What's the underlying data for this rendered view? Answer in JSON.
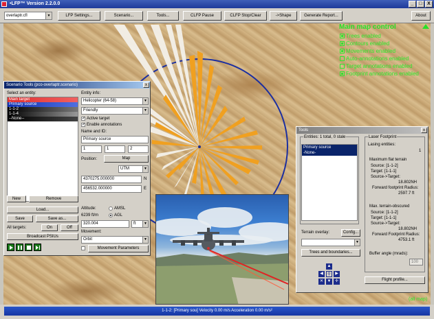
{
  "window": {
    "title": "•LFP™ Version 2.2.0.0",
    "buttons": [
      "_",
      "□",
      "X"
    ]
  },
  "toolbar": {
    "select_value": "overlaptr.cfl",
    "buttons": [
      "LFP Settings...",
      "Scenario...",
      "Tools...",
      "CLFP Pause",
      "CLFP Stop/Clear",
      "->Shape",
      "Generate Report...",
      "About"
    ]
  },
  "map_control": {
    "title": "Main map control",
    "items": [
      {
        "label": "Trees enabled",
        "checked": true
      },
      {
        "label": "Contours enabled",
        "checked": true
      },
      {
        "label": "Movements enabled",
        "checked": true
      },
      {
        "label": "Auto-annotations enabled",
        "checked": false
      },
      {
        "label": "Target annotations enabled",
        "checked": false
      },
      {
        "label": "Footprint annotations enabled",
        "checked": true
      }
    ]
  },
  "scenario_tools": {
    "title": "Scenario Tools (pco-overlaptr.scenario)",
    "select_entity_label": "Select an entity:",
    "entities": [
      {
        "label": "Main target",
        "style": "red"
      },
      {
        "label": "Primary source",
        "style": "blue"
      },
      {
        "label": "1-1-2",
        "style": "dark"
      },
      {
        "label": "1-1-4",
        "style": "dark"
      },
      {
        "label": "--None--",
        "style": "dark"
      }
    ],
    "entity_info_label": "Entity info:",
    "entity_type": "Helicopter (64-58)",
    "allegiance": "Friendly",
    "active_target_label": "Active target",
    "enable_annotations_label": "Enable annotations",
    "name_id_label": "Name and ID:",
    "name_value": "Primary source",
    "id_values": [
      "1",
      "1",
      "2"
    ],
    "position_label": "Position:",
    "map_button": "Map",
    "coord_system": "UTM",
    "northing": "4370275.000000",
    "northing_suffix": "N",
    "easting": "456532.000000",
    "easting_suffix": "E",
    "altitude_label": "Altitude:",
    "altitude_ground": "6239 ft/m",
    "amsl_label": "AMSL",
    "agl_label": "AGL",
    "altitude_value": "320.004",
    "altitude_unit": "ft",
    "movement_label": "Movement:",
    "movement_value": "Orbit",
    "movement_params_button": "Movement Parameters",
    "new_button": "New",
    "remove_button": "Remove",
    "load_button": "Load...",
    "save_button": "Save",
    "save_as_button": "Save as...",
    "all_targets_label": "All targets:",
    "on_button": "On",
    "off_button": "Off",
    "broadcast_button": "Broadcast PSIUs"
  },
  "tools_panel": {
    "title": "Tools",
    "entities_header": "Entities: 1 total, 0 stale",
    "entities": [
      {
        "label": "Primary source",
        "selected": true
      },
      {
        "label": "-None-",
        "selected": false
      }
    ],
    "laser_footprint_title": "Laser Footprint",
    "lasing_entities_label": "Lasing entities:",
    "lasing_entities_value": "1",
    "max_flat_label": "Maximum flat terrain",
    "source_label": "Source: [1-1-2]",
    "target_label": "Target: [1-1-1]",
    "source_target_label": "Source->Target:",
    "source_target_value": "18.802NH",
    "forward_footprint_label": "Forward footprint Radius:",
    "forward_footprint_value": "2597.7 ft",
    "max_obscured_label": "Max. terrain-obscured",
    "source2_label": "Source: [1-1-2]",
    "target2_label": "Target: [1-1-1]",
    "source_target2_label": "Source->Target:",
    "source_target2_value": "18.802NH",
    "forward_footprint2_label": "Forward Footprint Radius:",
    "forward_footprint2_value": "4753.1 ft",
    "buffer_angle_label": "Buffer angle (mrads):",
    "buffer_angle_value": "100",
    "terrain_overlay_label": "Terrain overlay:",
    "config_button": "Config...",
    "trees_boundaries_button": "Trees and boundaries...",
    "flight_profile_button": "Flight profile..."
  },
  "status_bar": {
    "text": "1-1-2: [Primary sou] Velocity 0.00 m/s  Acceleration 0.00 m/s²",
    "full_map_label": "(all map)"
  }
}
